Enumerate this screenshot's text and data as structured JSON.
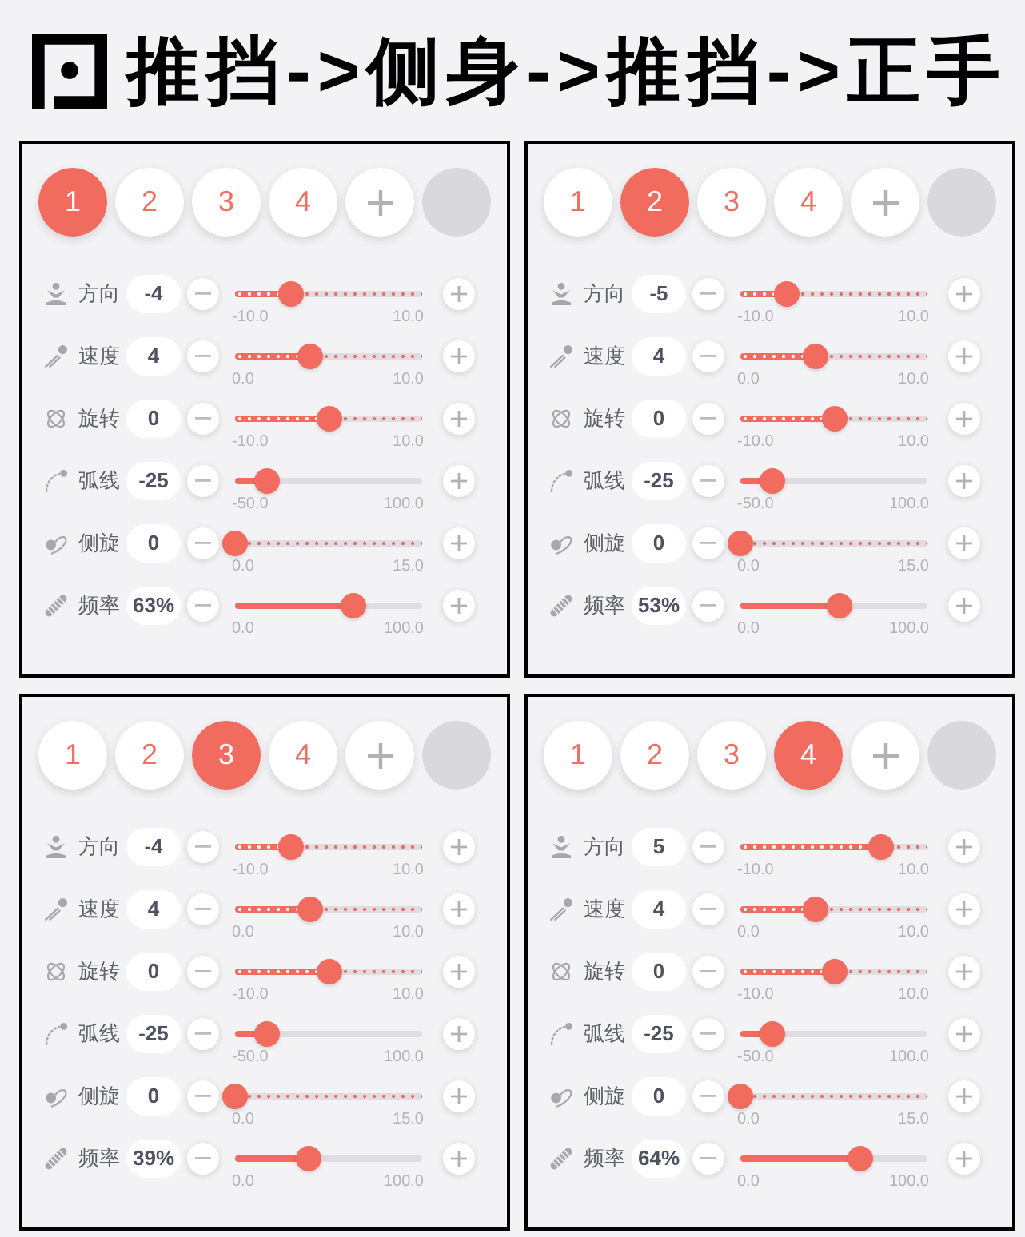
{
  "title": {
    "text": "推挡->侧身->推挡->正手"
  },
  "panels": [
    {
      "tabs": [
        {
          "label": "1",
          "selected": true
        },
        {
          "label": "2",
          "selected": false
        },
        {
          "label": "3",
          "selected": false
        },
        {
          "label": "4",
          "selected": false
        }
      ],
      "params": [
        {
          "label": "方向",
          "value": "-4",
          "kind": "dotted",
          "level": 0.3,
          "scale_min": "-10.0",
          "scale_max": "10.0"
        },
        {
          "label": "速度",
          "value": "4",
          "kind": "dotted",
          "level": 0.4,
          "scale_min": "0.0",
          "scale_max": "10.0"
        },
        {
          "label": "旋转",
          "value": "0",
          "kind": "dotted",
          "level": 0.5,
          "scale_min": "-10.0",
          "scale_max": "10.0"
        },
        {
          "label": "弧线",
          "value": "-25",
          "kind": "plain",
          "level": 0.1667,
          "scale_min": "-50.0",
          "scale_max": "100.0"
        },
        {
          "label": "侧旋",
          "value": "0",
          "kind": "dotted",
          "level": 0,
          "scale_min": "0.0",
          "scale_max": "15.0"
        },
        {
          "label": "频率",
          "value": "63%",
          "kind": "plain",
          "level": 0.63,
          "scale_min": "0.0",
          "scale_max": "100.0"
        }
      ]
    },
    {
      "tabs": [
        {
          "label": "1",
          "selected": false
        },
        {
          "label": "2",
          "selected": true
        },
        {
          "label": "3",
          "selected": false
        },
        {
          "label": "4",
          "selected": false
        }
      ],
      "params": [
        {
          "label": "方向",
          "value": "-5",
          "kind": "dotted",
          "level": 0.25,
          "scale_min": "-10.0",
          "scale_max": "10.0"
        },
        {
          "label": "速度",
          "value": "4",
          "kind": "dotted",
          "level": 0.4,
          "scale_min": "0.0",
          "scale_max": "10.0"
        },
        {
          "label": "旋转",
          "value": "0",
          "kind": "dotted",
          "level": 0.5,
          "scale_min": "-10.0",
          "scale_max": "10.0"
        },
        {
          "label": "弧线",
          "value": "-25",
          "kind": "plain",
          "level": 0.1667,
          "scale_min": "-50.0",
          "scale_max": "100.0"
        },
        {
          "label": "侧旋",
          "value": "0",
          "kind": "dotted",
          "level": 0,
          "scale_min": "0.0",
          "scale_max": "15.0"
        },
        {
          "label": "频率",
          "value": "53%",
          "kind": "plain",
          "level": 0.53,
          "scale_min": "0.0",
          "scale_max": "100.0"
        }
      ]
    },
    {
      "tabs": [
        {
          "label": "1",
          "selected": false
        },
        {
          "label": "2",
          "selected": false
        },
        {
          "label": "3",
          "selected": true
        },
        {
          "label": "4",
          "selected": false
        }
      ],
      "params": [
        {
          "label": "方向",
          "value": "-4",
          "kind": "dotted",
          "level": 0.3,
          "scale_min": "-10.0",
          "scale_max": "10.0"
        },
        {
          "label": "速度",
          "value": "4",
          "kind": "dotted",
          "level": 0.4,
          "scale_min": "0.0",
          "scale_max": "10.0"
        },
        {
          "label": "旋转",
          "value": "0",
          "kind": "dotted",
          "level": 0.5,
          "scale_min": "-10.0",
          "scale_max": "10.0"
        },
        {
          "label": "弧线",
          "value": "-25",
          "kind": "plain",
          "level": 0.1667,
          "scale_min": "-50.0",
          "scale_max": "100.0"
        },
        {
          "label": "侧旋",
          "value": "0",
          "kind": "dotted",
          "level": 0,
          "scale_min": "0.0",
          "scale_max": "15.0"
        },
        {
          "label": "频率",
          "value": "39%",
          "kind": "plain",
          "level": 0.39,
          "scale_min": "0.0",
          "scale_max": "100.0"
        }
      ]
    },
    {
      "tabs": [
        {
          "label": "1",
          "selected": false
        },
        {
          "label": "2",
          "selected": false
        },
        {
          "label": "3",
          "selected": false
        },
        {
          "label": "4",
          "selected": true
        }
      ],
      "params": [
        {
          "label": "方向",
          "value": "5",
          "kind": "dotted",
          "level": 0.75,
          "scale_min": "-10.0",
          "scale_max": "10.0"
        },
        {
          "label": "速度",
          "value": "4",
          "kind": "dotted",
          "level": 0.4,
          "scale_min": "0.0",
          "scale_max": "10.0"
        },
        {
          "label": "旋转",
          "value": "0",
          "kind": "dotted",
          "level": 0.5,
          "scale_min": "-10.0",
          "scale_max": "10.0"
        },
        {
          "label": "弧线",
          "value": "-25",
          "kind": "plain",
          "level": 0.1667,
          "scale_min": "-50.0",
          "scale_max": "100.0"
        },
        {
          "label": "侧旋",
          "value": "0",
          "kind": "dotted",
          "level": 0,
          "scale_min": "0.0",
          "scale_max": "15.0"
        },
        {
          "label": "频率",
          "value": "64%",
          "kind": "plain",
          "level": 0.64,
          "scale_min": "0.0",
          "scale_max": "100.0"
        }
      ]
    }
  ]
}
